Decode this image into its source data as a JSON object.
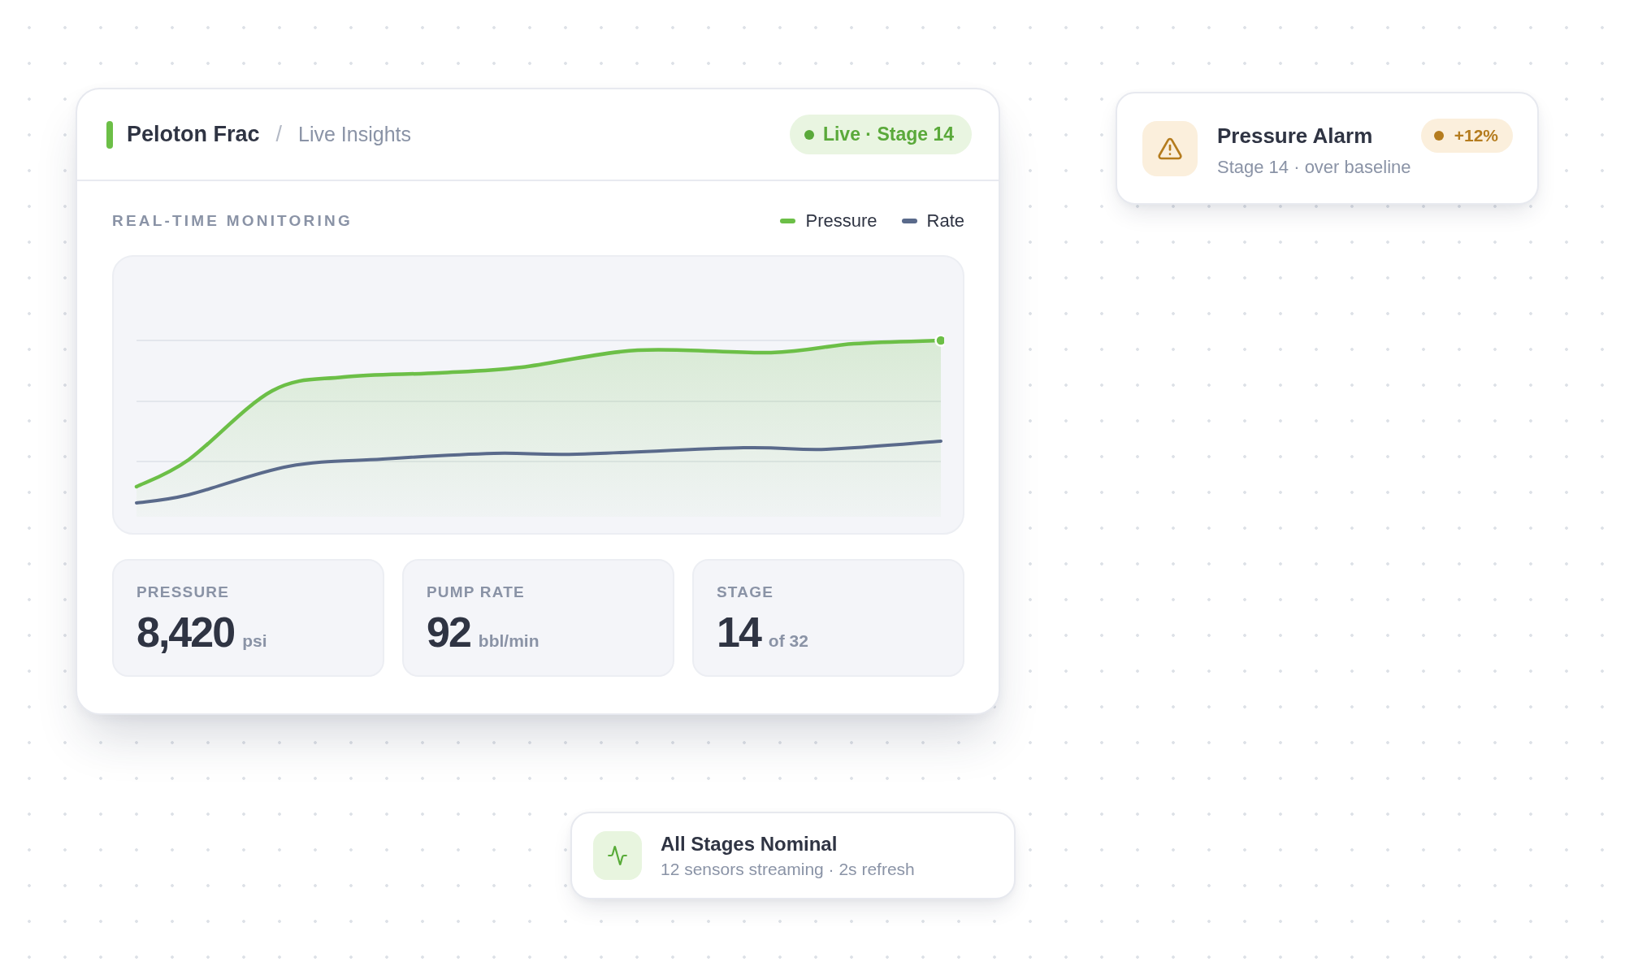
{
  "main_card": {
    "title": "Peloton Frac",
    "separator": "/",
    "subtitle": "Live Insights",
    "status_pill": {
      "label": "Live · Stage 14"
    },
    "section_title": "REAL-TIME MONITORING",
    "legend": [
      {
        "label": "Pressure",
        "color": "#6cbf47"
      },
      {
        "label": "Rate",
        "color": "#5a6a8b"
      }
    ],
    "stats": [
      {
        "label": "PRESSURE",
        "value": "8,420",
        "unit": "psi"
      },
      {
        "label": "PUMP RATE",
        "value": "92",
        "unit": "bbl/min"
      },
      {
        "label": "STAGE",
        "value": "14",
        "unit": "of 32"
      }
    ]
  },
  "alerts": [
    {
      "kind": "warning",
      "title": "Pressure Alarm",
      "detail": "Stage 14 · over baseline",
      "badge": "+12%"
    },
    {
      "kind": "ok",
      "title": "All Stages Nominal",
      "detail": "12 sensors streaming · 2s refresh"
    }
  ]
}
